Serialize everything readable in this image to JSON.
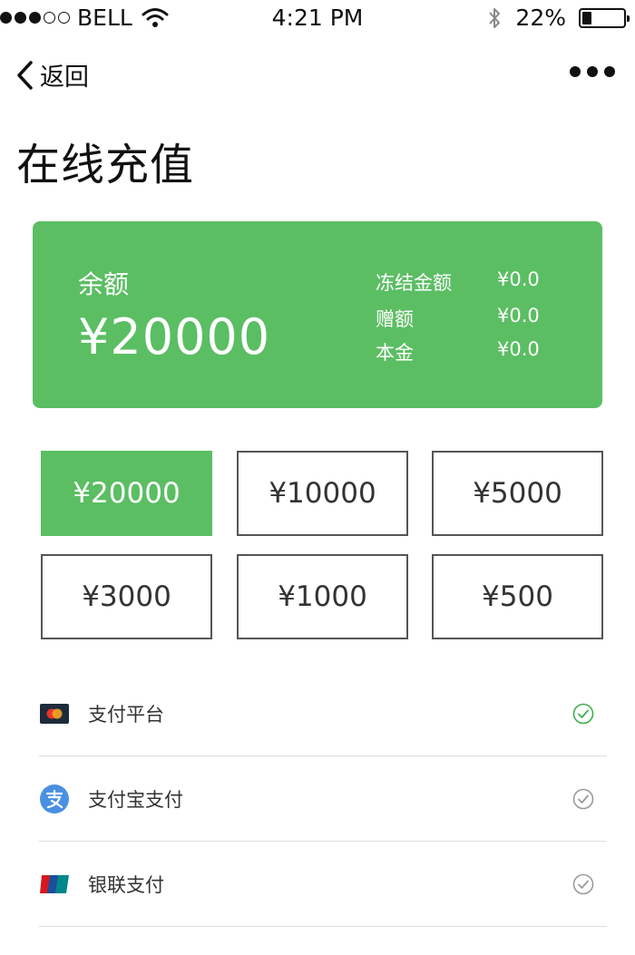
{
  "status_bar": {
    "carrier": "BELL",
    "time": "4:21 PM",
    "battery_text": "22%",
    "battery_level": 0.22
  },
  "nav": {
    "back_label": "返回"
  },
  "page": {
    "title": "在线充值"
  },
  "balance": {
    "label": "余额",
    "amount": "¥20000",
    "details": [
      {
        "label": "冻结金额",
        "value": "¥0.0"
      },
      {
        "label": "赠额",
        "value": "¥0.0"
      },
      {
        "label": "本金",
        "value": "¥0.0"
      }
    ]
  },
  "amounts": [
    {
      "label": "¥20000",
      "selected": true
    },
    {
      "label": "¥10000",
      "selected": false
    },
    {
      "label": "¥5000",
      "selected": false
    },
    {
      "label": "¥3000",
      "selected": false
    },
    {
      "label": "¥1000",
      "selected": false
    },
    {
      "label": "¥500",
      "selected": false
    }
  ],
  "payment_methods": [
    {
      "label": "支付平台",
      "icon": "mastercard-icon",
      "selected": true
    },
    {
      "label": "支付宝支付",
      "icon": "alipay-icon",
      "selected": false
    },
    {
      "label": "银联支付",
      "icon": "unionpay-icon",
      "selected": false
    }
  ],
  "colors": {
    "accent": "#5bbe63",
    "check_active": "#3fae4a",
    "check_inactive": "#9a9a9a",
    "alipay_blue": "#4a90e2"
  }
}
